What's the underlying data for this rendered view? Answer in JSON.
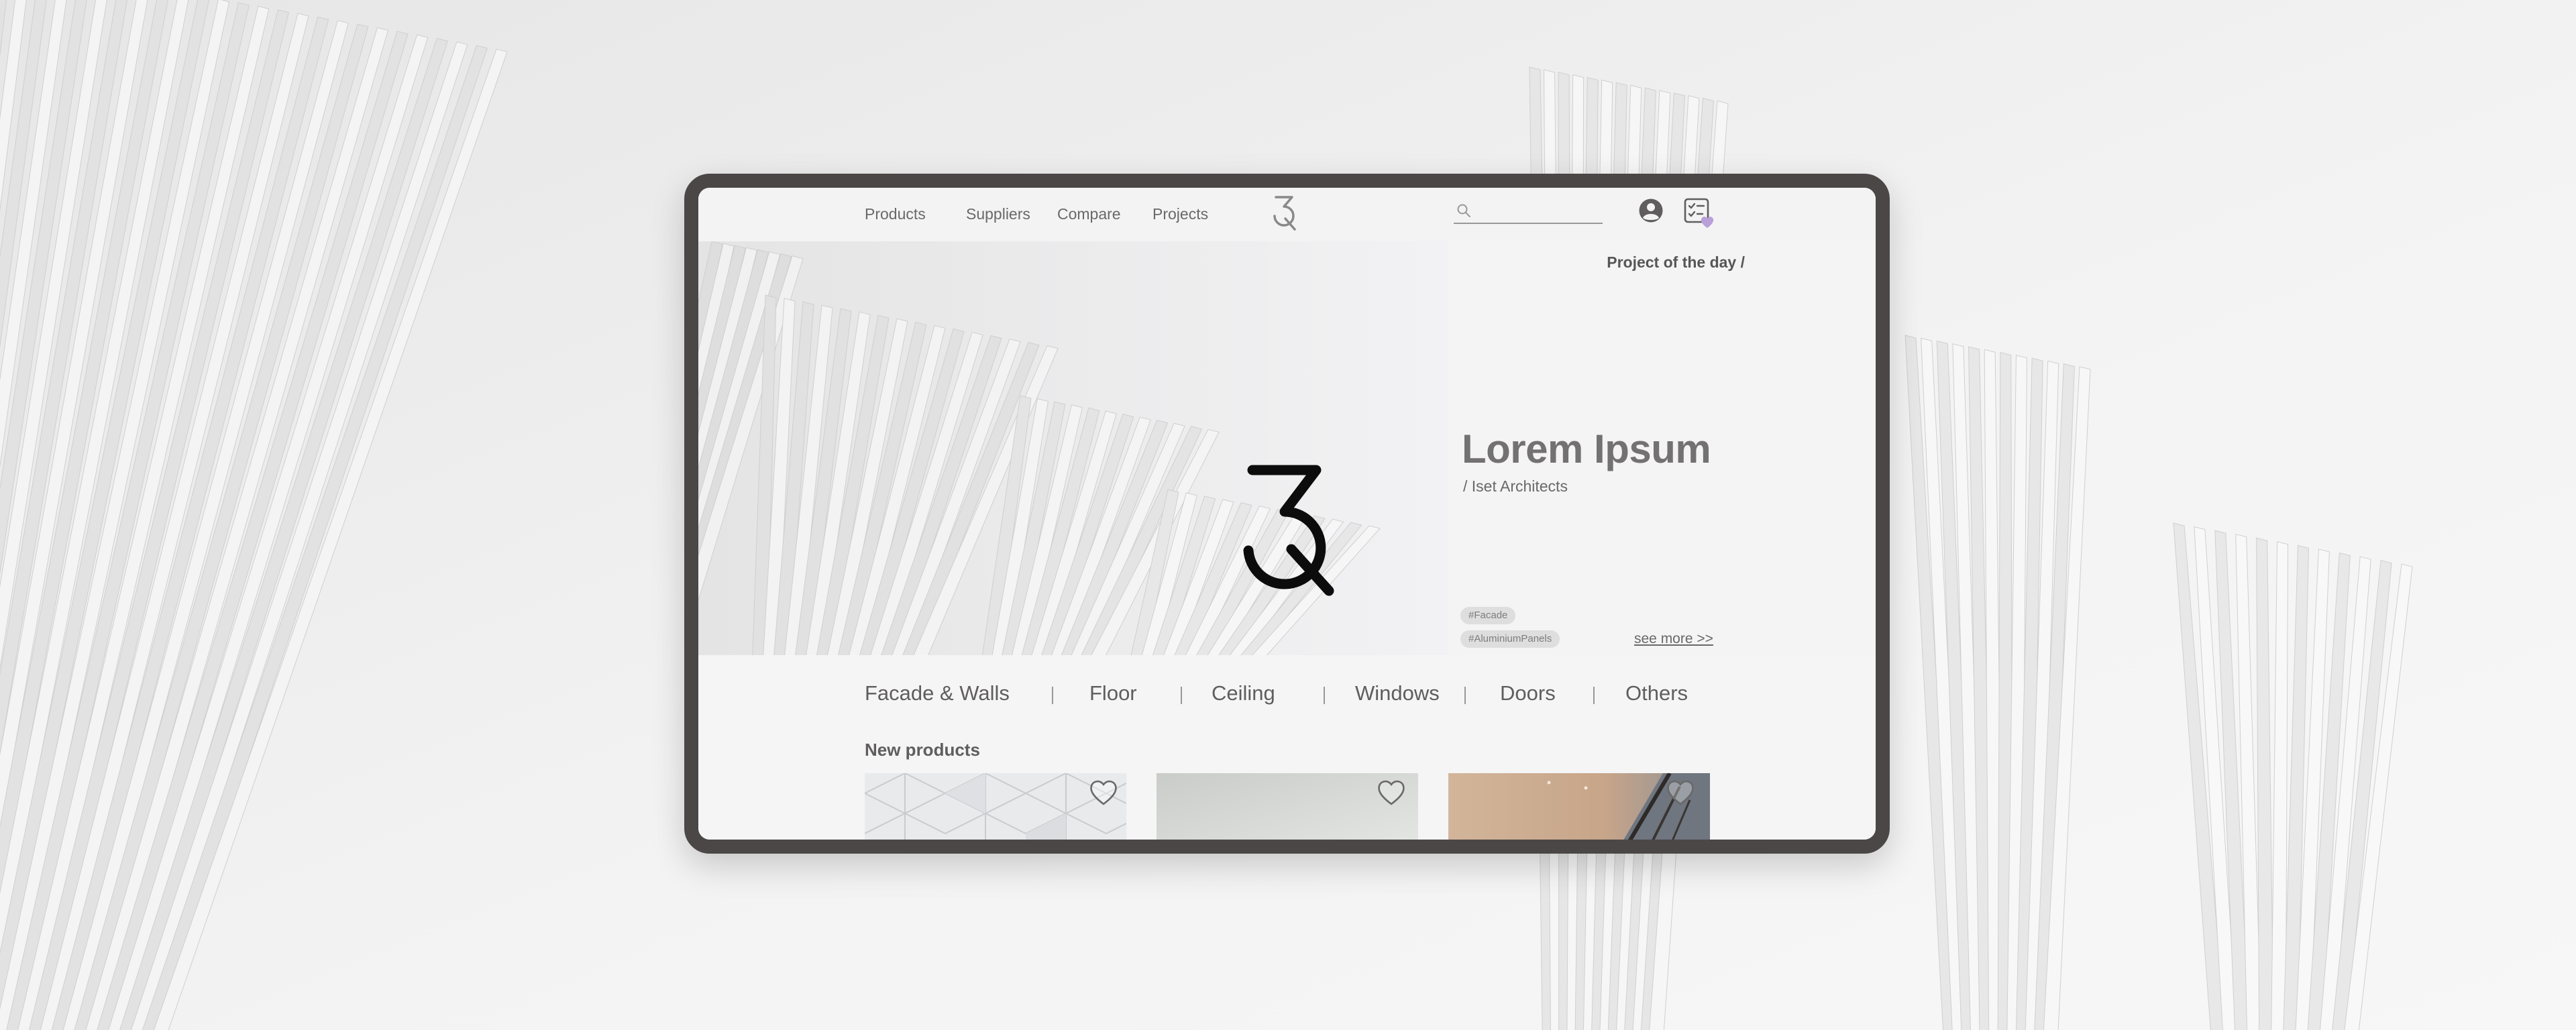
{
  "nav": {
    "links": [
      "Products",
      "Suppliers",
      "Compare",
      "Projects"
    ],
    "brand_logo_icon": "3q-logo-icon",
    "search": {
      "value": "",
      "placeholder": ""
    },
    "account_icon": "user-circle-icon",
    "compare_icon": "compare-list-icon",
    "compare_badge_icon": "heart-icon",
    "badge_color": "#b9a0d9"
  },
  "hero": {
    "label": "Project of the day /",
    "title": "Lorem Ipsum",
    "architect": "/ Iset Architects",
    "tags": [
      "#Facade",
      "#AluminiumPanels"
    ],
    "see_more": "see more >>",
    "logo_icon": "3q-logo-icon"
  },
  "categories": [
    "Facade & Walls",
    "Floor",
    "Ceiling",
    "Windows",
    "Doors",
    "Others"
  ],
  "new_products": {
    "title": "New products",
    "items": [
      {
        "image": "white-triangular-panels-image",
        "favorite_icon": "heart-outline-icon"
      },
      {
        "image": "grey-wall-image",
        "favorite_icon": "heart-outline-icon"
      },
      {
        "image": "interior-window-image",
        "favorite_icon": "heart-outline-icon"
      }
    ]
  },
  "colors": {
    "frame": "#4b4746",
    "text": "#5f5d5d",
    "accent": "#b9a0d9"
  }
}
